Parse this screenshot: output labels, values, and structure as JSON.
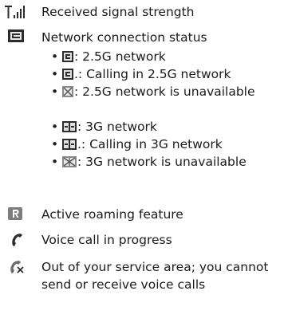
{
  "rows": [
    {
      "icon": "signal-strength-icon",
      "text": "Received signal strength"
    },
    {
      "icon": "network-status-icon",
      "text": "Network connection status"
    },
    {
      "icon": "roaming-icon",
      "text": "Active roaming feature"
    },
    {
      "icon": "voice-call-icon",
      "text": "Voice call in progress"
    },
    {
      "icon": "no-service-icon",
      "text": "Out of your service area; you cannot send or receive voice calls"
    }
  ],
  "network_items": [
    {
      "icon": "2.5g-network-icon",
      "text": ": 2.5G network"
    },
    {
      "icon": "2.5g-calling-icon",
      "text": ".: Calling in 2.5G network"
    },
    {
      "icon": "2.5g-unavailable-icon",
      "text": ": 2.5G network is unavailable"
    },
    {
      "icon": "3g-network-icon",
      "text": ": 3G network"
    },
    {
      "icon": "3g-calling-icon",
      "text": ".: Calling in 3G network"
    },
    {
      "icon": "3g-unavailable-icon",
      "text": ": 3G network is unavailable"
    }
  ],
  "bullet": "•"
}
